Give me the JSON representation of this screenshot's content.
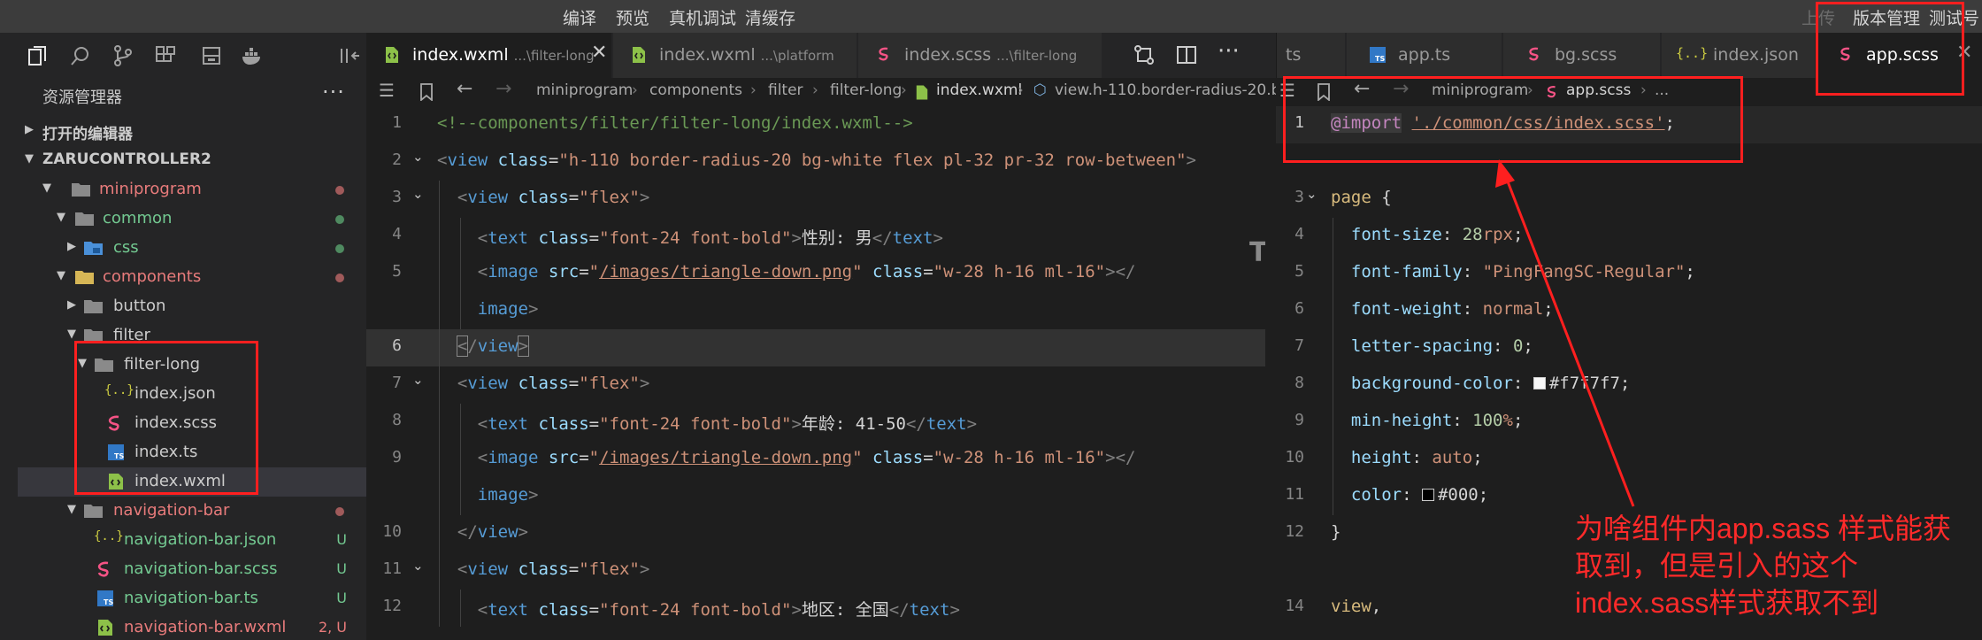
{
  "menubar": {
    "items": [
      "编译",
      "预览",
      "真机调试",
      "清缓存"
    ],
    "right_items": [
      "上传",
      "版本管理",
      "测试号"
    ]
  },
  "activity_icons": [
    "explorer-icon",
    "search-icon",
    "source-control-icon",
    "extensions-icon",
    "storage-icon",
    "docker-icon",
    "layout-icon"
  ],
  "sidebar": {
    "title": "资源管理器",
    "more": "···",
    "open_editors": "打开的编辑器",
    "project": "ZARUCONTROLLER2",
    "tree": [
      {
        "label": "miniprogram",
        "color": "#e87b7b",
        "deco_dot": "#a05a5a"
      },
      {
        "label": "common",
        "color": "#73c991",
        "deco_dot": "#4f8a60"
      },
      {
        "label": "css",
        "color": "#73c991",
        "deco_dot": "#4f8a60"
      },
      {
        "label": "components",
        "color": "#e87b7b",
        "deco_dot": "#a05a5a"
      },
      {
        "label": "button",
        "color": "#cccccc"
      },
      {
        "label": "filter",
        "color": "#cccccc"
      },
      {
        "label": "filter-long",
        "color": "#cccccc"
      },
      {
        "label": "index.json",
        "color": "#cccccc"
      },
      {
        "label": "index.scss",
        "color": "#cccccc"
      },
      {
        "label": "index.ts",
        "color": "#cccccc"
      },
      {
        "label": "index.wxml",
        "color": "#cccccc"
      },
      {
        "label": "navigation-bar",
        "color": "#e87b7b",
        "deco_dot": "#a05a5a"
      },
      {
        "label": "navigation-bar.json",
        "color": "#73c991",
        "deco_text": "U"
      },
      {
        "label": "navigation-bar.scss",
        "color": "#73c991",
        "deco_text": "U"
      },
      {
        "label": "navigation-bar.ts",
        "color": "#73c991",
        "deco_text": "U"
      },
      {
        "label": "navigation-bar.wxml",
        "color": "#e87b7b",
        "deco_text": "2, U"
      }
    ]
  },
  "tabs_left": [
    {
      "name": "index.wxml",
      "path": "...\\filter-long",
      "active": true
    },
    {
      "name": "index.wxml",
      "path": "...\\platform",
      "active": false
    },
    {
      "name": "index.scss",
      "path": "...\\filter-long",
      "active": false
    }
  ],
  "tabs_right": [
    {
      "name": "ts"
    },
    {
      "name": "app.ts"
    },
    {
      "name": "bg.scss"
    },
    {
      "name": "index.json"
    },
    {
      "name": "app.scss",
      "active": true
    }
  ],
  "breadcrumbs_left": [
    "miniprogram",
    "components",
    "filter",
    "filter-long",
    "index.wxml",
    "view.h-110.border-radius-20.b"
  ],
  "breadcrumbs_right": [
    "miniprogram",
    "app.scss",
    "..."
  ],
  "editor_left": {
    "lines": [
      {
        "n": "1",
        "t": "<!--components/filter/filter-long/index.wxml-->"
      },
      {
        "n": "2",
        "t": "<view class=\"h-110 border-radius-20 bg-white flex pl-32 pr-32 row-between\">"
      },
      {
        "n": "3",
        "t": "  <view class=\"flex\">"
      },
      {
        "n": "4",
        "t": "    <text class=\"font-24 font-bold\">性别: 男</text>"
      },
      {
        "n": "5",
        "t": "    <image src=\"/images/triangle-down.png\" class=\"w-28 h-16 ml-16\"></"
      },
      {
        "n": "",
        "t": "    image>"
      },
      {
        "n": "6",
        "t": "  </view>"
      },
      {
        "n": "7",
        "t": "  <view class=\"flex\">"
      },
      {
        "n": "8",
        "t": "    <text class=\"font-24 font-bold\">年龄: 41-50</text>"
      },
      {
        "n": "9",
        "t": "    <image src=\"/images/triangle-down.png\" class=\"w-28 h-16 ml-16\"></"
      },
      {
        "n": "",
        "t": "    image>"
      },
      {
        "n": "10",
        "t": "  </view>"
      },
      {
        "n": "11",
        "t": "  <view class=\"flex\">"
      },
      {
        "n": "12",
        "t": "    <text class=\"font-24 font-bold\">地区: 全国</text>"
      }
    ]
  },
  "editor_right": {
    "lines": [
      {
        "n": "1",
        "t": "@import './common/css/index.scss';"
      },
      {
        "n": "",
        "t": ""
      },
      {
        "n": "3",
        "t": "page {"
      },
      {
        "n": "4",
        "t": "  font-size: 28rpx;"
      },
      {
        "n": "5",
        "t": "  font-family: \"PingFangSC-Regular\";"
      },
      {
        "n": "6",
        "t": "  font-weight: normal;"
      },
      {
        "n": "7",
        "t": "  letter-spacing: 0;"
      },
      {
        "n": "8",
        "t": "  background-color: #f7f7f7;"
      },
      {
        "n": "9",
        "t": "  min-height: 100%;"
      },
      {
        "n": "10",
        "t": "  height: auto;"
      },
      {
        "n": "11",
        "t": "  color: #000;"
      },
      {
        "n": "12",
        "t": "}"
      },
      {
        "n": "",
        "t": ""
      },
      {
        "n": "14",
        "t": "view,"
      }
    ]
  },
  "annotation": {
    "line1": "为啥组件内app.sass 样式能获",
    "line2": "取到，但是引入的这个",
    "line3": "index.sass样式获取不到"
  },
  "colors": {
    "annotation_red": "#ff1f1f",
    "accent_scss": "#f55385",
    "accent_ts": "#3178c6",
    "accent_json": "#cbcb41",
    "accent_wxml": "#8dc149"
  }
}
